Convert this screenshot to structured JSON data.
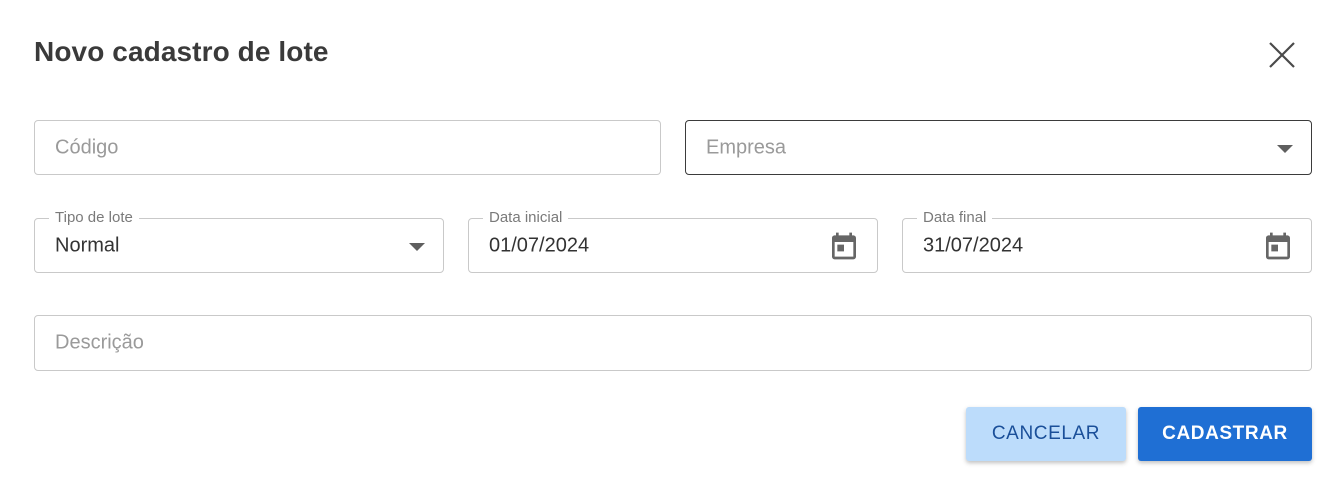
{
  "dialog": {
    "title": "Novo cadastro de lote",
    "close_icon": "close-icon"
  },
  "form": {
    "codigo": {
      "placeholder": "Código"
    },
    "empresa": {
      "placeholder": "Empresa",
      "icon": "chevron-down-icon"
    },
    "tipo_lote": {
      "label": "Tipo de lote",
      "value": "Normal",
      "icon": "chevron-down-icon"
    },
    "data_inicial": {
      "label": "Data inicial",
      "value": "01/07/2024",
      "icon": "calendar-icon"
    },
    "data_final": {
      "label": "Data final",
      "value": "31/07/2024",
      "icon": "calendar-icon"
    },
    "descricao": {
      "placeholder": "Descrição"
    }
  },
  "actions": {
    "cancel_label": "CANCELAR",
    "submit_label": "CADASTRAR"
  },
  "colors": {
    "primary": "#1f6fd4",
    "primary_light": "#bcdcfb",
    "border": "#c9c9c9",
    "text": "#333333"
  }
}
